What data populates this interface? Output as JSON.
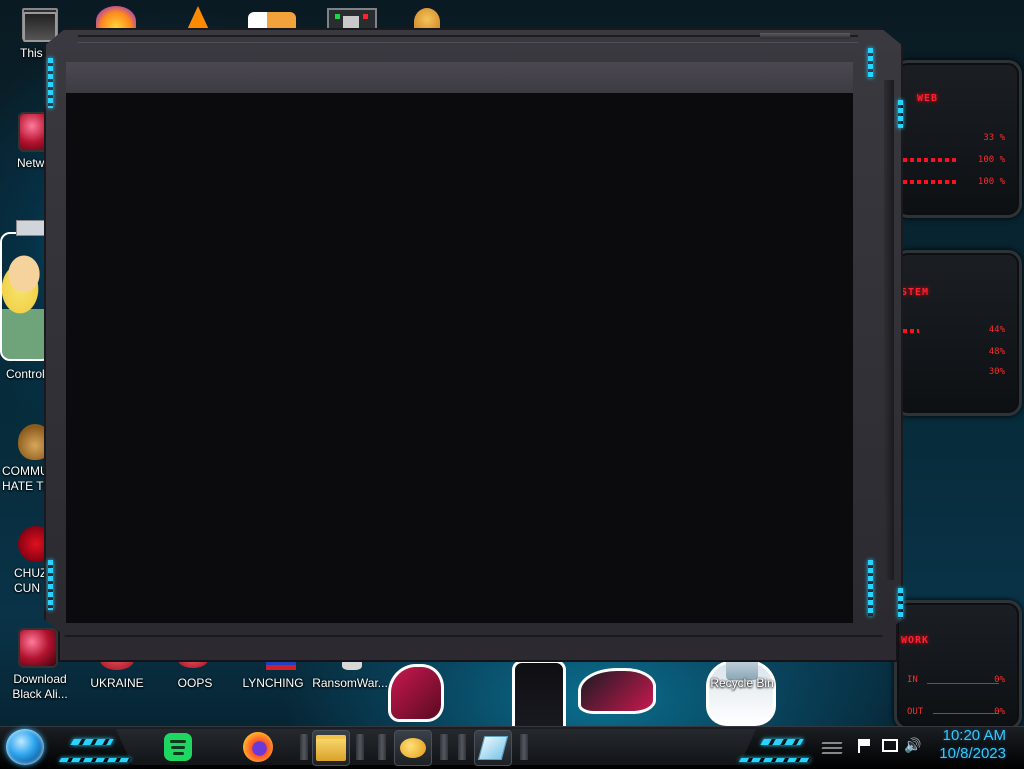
{
  "desktop_icons": [
    {
      "label": "This P",
      "icon": "this-pc-icon"
    },
    {
      "label": "Netwo",
      "icon": "network-icon"
    },
    {
      "label": "Control P",
      "icon": "control-panel-icon"
    },
    {
      "label": "COMMUN\nHATE THI",
      "icon": "money-bag-icon"
    },
    {
      "label": "CHUZ\nCUN",
      "icon": "red-blob-icon"
    },
    {
      "label": "Download\nBlack Ali...",
      "icon": "red-orb-icon"
    },
    {
      "label": "UKRAINE",
      "icon": "red-orb-icon"
    },
    {
      "label": "OOPS",
      "icon": "red-orb-icon"
    },
    {
      "label": "LYNCHING",
      "icon": "flag-icon"
    },
    {
      "label": "RansomWar...",
      "icon": "skull-icon"
    },
    {
      "label": "Recycle Bin",
      "icon": "recycle-bin-icon"
    }
  ],
  "widgets": {
    "web": {
      "title": "WEB",
      "rows": [
        "33 %",
        "100 %",
        "100 %"
      ]
    },
    "system": {
      "title": "STEM",
      "rows": [
        "44%",
        "48%",
        "30%"
      ]
    },
    "network": {
      "title": "WORK",
      "in_label": "IN",
      "out_label": "OUT",
      "in_value": "0%",
      "out_value": "0%"
    }
  },
  "taskbar": {
    "apps": [
      {
        "name": "spotify",
        "icon": "spotify-icon",
        "color": "#1ed760"
      },
      {
        "name": "firefox",
        "icon": "firefox-icon",
        "color": "#ff7b1c"
      },
      {
        "name": "file-explorer",
        "icon": "folder-icon",
        "color": "#f2c44a"
      },
      {
        "name": "chat",
        "icon": "speech-bubble-icon",
        "color": "#f2b51c"
      },
      {
        "name": "notes",
        "icon": "notes-icon",
        "color": "#9fd8ef"
      }
    ],
    "clock_time": "10:20 AM",
    "clock_date": "10/8/2023"
  },
  "window": {
    "title": ""
  },
  "colors": {
    "accent_cyan": "#26d4ff",
    "widget_red": "#ff1020",
    "clock_blue": "#35c8ff"
  }
}
